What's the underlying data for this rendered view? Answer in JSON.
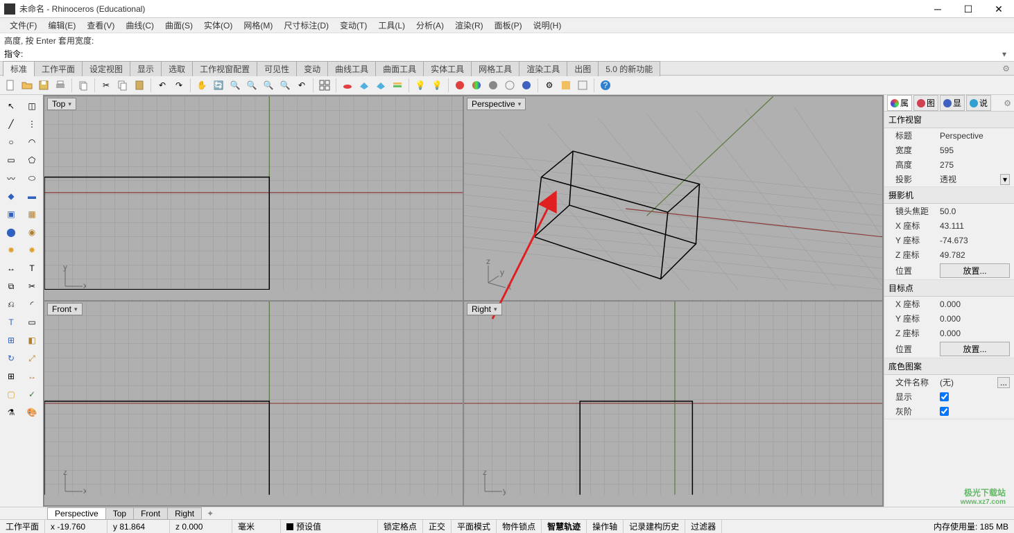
{
  "title": "未命名 - Rhinoceros (Educational)",
  "menu": [
    "文件(F)",
    "编辑(E)",
    "查看(V)",
    "曲线(C)",
    "曲面(S)",
    "实体(O)",
    "网格(M)",
    "尺寸标注(D)",
    "变动(T)",
    "工具(L)",
    "分析(A)",
    "渲染(R)",
    "面板(P)",
    "说明(H)"
  ],
  "command_history": "高度, 按 Enter 套用宽度:",
  "command_label": "指令:",
  "toolbar_tabs": [
    "标准",
    "工作平面",
    "设定视图",
    "显示",
    "选取",
    "工作视窗配置",
    "可见性",
    "变动",
    "曲线工具",
    "曲面工具",
    "实体工具",
    "网格工具",
    "渲染工具",
    "出图",
    "5.0 的新功能"
  ],
  "viewports": {
    "top": "Top",
    "perspective": "Perspective",
    "front": "Front",
    "right": "Right"
  },
  "right_tabs": [
    {
      "label": "属",
      "color": "#f0a030"
    },
    {
      "label": "图",
      "color": "#d04050"
    },
    {
      "label": "显",
      "color": "#4060c0"
    },
    {
      "label": "说",
      "color": "#30a0d0"
    }
  ],
  "properties": {
    "section1": {
      "header": "工作视窗",
      "rows": [
        {
          "key": "标题",
          "val": "Perspective"
        },
        {
          "key": "宽度",
          "val": "595"
        },
        {
          "key": "高度",
          "val": "275"
        },
        {
          "key": "投影",
          "val": "透视",
          "dropdown": true
        }
      ]
    },
    "section2": {
      "header": "摄影机",
      "rows": [
        {
          "key": "镜头焦距",
          "val": "50.0"
        },
        {
          "key": "X 座标",
          "val": "43.111"
        },
        {
          "key": "Y 座标",
          "val": "-74.673"
        },
        {
          "key": "Z 座标",
          "val": "49.782"
        },
        {
          "key": "位置",
          "btn": "放置..."
        }
      ]
    },
    "section3": {
      "header": "目标点",
      "rows": [
        {
          "key": "X 座标",
          "val": "0.000"
        },
        {
          "key": "Y 座标",
          "val": "0.000"
        },
        {
          "key": "Z 座标",
          "val": "0.000"
        },
        {
          "key": "位置",
          "btn": "放置..."
        }
      ]
    },
    "section4": {
      "header": "底色图案",
      "rows": [
        {
          "key": "文件名称",
          "val": "(无)",
          "ellipsis": true
        },
        {
          "key": "显示",
          "checkbox": true,
          "checked": true
        },
        {
          "key": "灰阶",
          "checkbox": true,
          "checked": true
        }
      ]
    }
  },
  "view_tabs": [
    "Perspective",
    "Top",
    "Front",
    "Right"
  ],
  "status": {
    "cplane": "工作平面",
    "x": "x -19.760",
    "y": "y 81.864",
    "z": "z 0.000",
    "units": "毫米",
    "layer": "预设值",
    "cells": [
      "锁定格点",
      "正交",
      "平面模式",
      "物件锁点",
      "智慧轨迹",
      "操作轴",
      "记录建构历史",
      "过滤器"
    ],
    "bold_cell": "智慧轨迹",
    "memory": "内存使用量: 185 MB"
  },
  "watermark": {
    "main": "极光下载站",
    "sub": "www.xz7.com"
  }
}
